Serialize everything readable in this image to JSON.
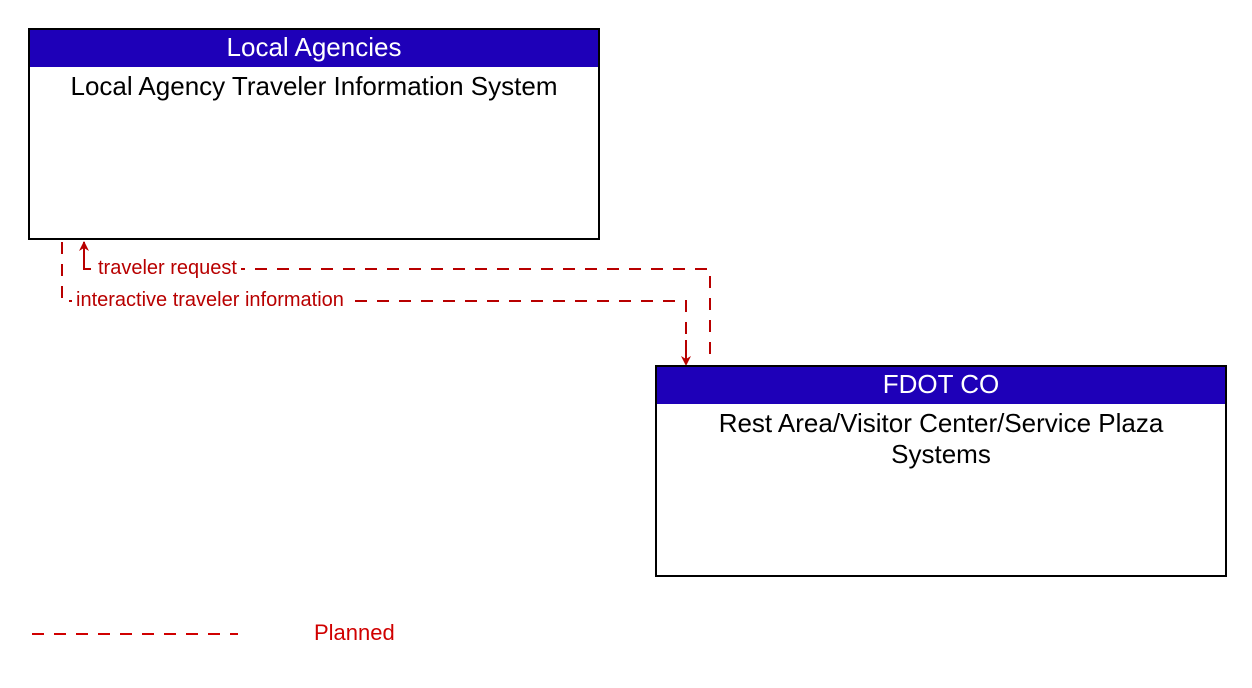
{
  "nodes": {
    "topLeft": {
      "header": "Local Agencies",
      "body": "Local Agency Traveler Information System"
    },
    "bottomRight": {
      "header": "FDOT CO",
      "body": "Rest Area/Visitor Center/Service Plaza Systems"
    }
  },
  "flows": {
    "travelerRequest": "traveler request",
    "interactiveInfo": "interactive traveler information"
  },
  "legend": {
    "planned": "Planned"
  },
  "colors": {
    "header": "#1e00b8",
    "flow": "#b80000"
  }
}
